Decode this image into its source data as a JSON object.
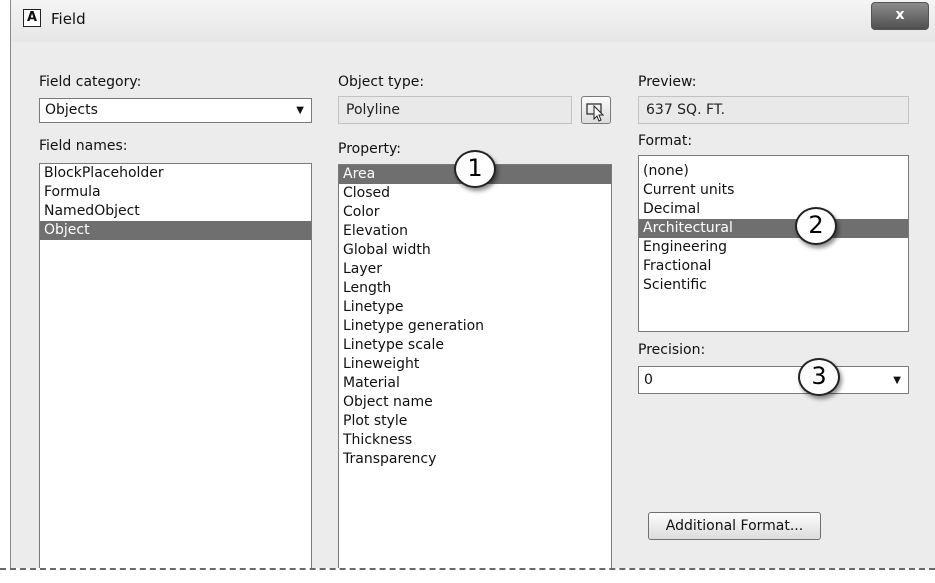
{
  "window": {
    "icon_letter": "A",
    "title": "Field",
    "close_glyph": "x"
  },
  "field_category": {
    "label": "Field category:",
    "value": "Objects"
  },
  "field_names": {
    "label": "Field names:",
    "items": [
      "BlockPlaceholder",
      "Formula",
      "NamedObject",
      "Object"
    ],
    "selected": "Object"
  },
  "object_type": {
    "label": "Object type:",
    "value": "Polyline",
    "picker_icon": "select-object-icon"
  },
  "property": {
    "label": "Property:",
    "items": [
      "Area",
      "Closed",
      "Color",
      "Elevation",
      "Global width",
      "Layer",
      "Length",
      "Linetype",
      "Linetype generation",
      "Linetype scale",
      "Lineweight",
      "Material",
      "Object name",
      "Plot style",
      "Thickness",
      "Transparency"
    ],
    "selected": "Area"
  },
  "preview": {
    "label": "Preview:",
    "value": "637 SQ. FT."
  },
  "format": {
    "label": "Format:",
    "items": [
      "(none)",
      "Current units",
      "Decimal",
      "Architectural",
      "Engineering",
      "Fractional",
      "Scientific"
    ],
    "selected": "Architectural"
  },
  "precision": {
    "label": "Precision:",
    "value": "0"
  },
  "additional_format_button": "Additional Format...",
  "callouts": [
    "1",
    "2",
    "3"
  ],
  "colors": {
    "selection": "#6f6f6f",
    "dialog_bg": "#ececec"
  }
}
